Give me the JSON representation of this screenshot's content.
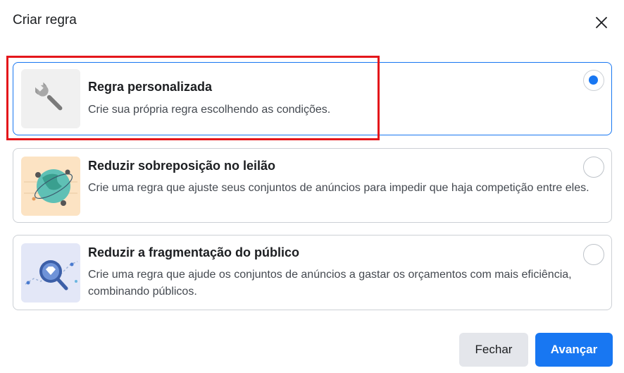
{
  "dialog": {
    "title": "Criar regra"
  },
  "options": [
    {
      "title": "Regra personalizada",
      "description": "Crie sua própria regra escolhendo as condições.",
      "selected": true,
      "icon": "wrench-icon"
    },
    {
      "title": "Reduzir sobreposição no leilão",
      "description": "Crie uma regra que ajuste seus conjuntos de anúncios para impedir que haja competição entre eles.",
      "selected": false,
      "icon": "globe-icon"
    },
    {
      "title": "Reduzir a fragmentação do público",
      "description": "Crie uma regra que ajude os conjuntos de anúncios a gastar os orçamentos com mais eficiência, combinando públicos.",
      "selected": false,
      "icon": "magnifier-diamond-icon"
    }
  ],
  "footer": {
    "close_label": "Fechar",
    "next_label": "Avançar"
  },
  "colors": {
    "accent": "#1877f2",
    "highlight": "#e4161b"
  }
}
